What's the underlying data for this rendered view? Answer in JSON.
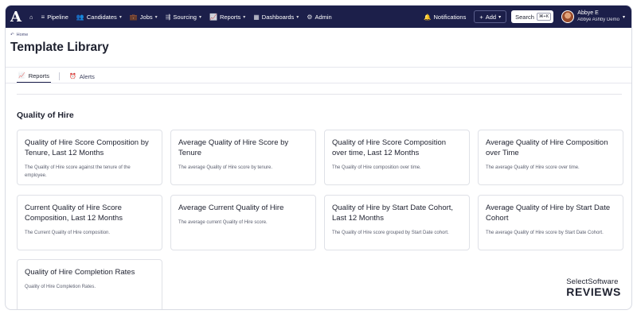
{
  "topnav": {
    "logo": "A",
    "items": [
      {
        "label": "Pipeline",
        "icon": "≡",
        "chev": false
      },
      {
        "label": "Candidates",
        "icon": "👥",
        "chev": true
      },
      {
        "label": "Jobs",
        "icon": "💼",
        "chev": true
      },
      {
        "label": "Sourcing",
        "icon": "⇶",
        "chev": true
      },
      {
        "label": "Reports",
        "icon": "📈",
        "chev": true
      },
      {
        "label": "Dashboards",
        "icon": "▦",
        "chev": true
      },
      {
        "label": "Admin",
        "icon": "⚙",
        "chev": false
      }
    ],
    "notifications_label": "Notifications",
    "add_label": "Add",
    "search_label": "Search",
    "search_shortcut": "⌘+K",
    "user_name": "Abbye E",
    "user_org": "Abbye Ashby Demo"
  },
  "breadcrumb": {
    "label": "Home"
  },
  "page_title": "Template Library",
  "tabs": [
    {
      "label": "Reports",
      "icon": "📈",
      "active": true
    },
    {
      "label": "Alerts",
      "icon": "⏰",
      "active": false
    }
  ],
  "section": {
    "title": "Quality of Hire"
  },
  "cards": [
    {
      "title": "Quality of Hire Score Composition by Tenure, Last 12 Months",
      "description": "The Quality of Hire score against the tenure of the employee."
    },
    {
      "title": "Average Quality of Hire Score by Tenure",
      "description": "The average Quality of Hire score by tenure."
    },
    {
      "title": "Quality of Hire Score Composition over time, Last 12 Months",
      "description": "The Quality of Hire composition over time."
    },
    {
      "title": "Average Quality of Hire Composition over Time",
      "description": "The average Quality of Hire score over time."
    },
    {
      "title": "Current Quality of Hire Score Composition, Last 12 Months",
      "description": "The Current Quality of Hire composition."
    },
    {
      "title": "Average Current Quality of Hire",
      "description": "The average current Quality of Hire score."
    },
    {
      "title": "Quality of Hire by Start Date Cohort, Last 12 Months",
      "description": "The Quality of Hire score grouped by Start Date cohort."
    },
    {
      "title": "Average Quality of Hire by Start Date Cohort",
      "description": "The average Quality of Hire score by Start Date Cohort."
    },
    {
      "title": "Quality of Hire Completion Rates",
      "description": "Quality of Hire Completion Rates."
    }
  ],
  "watermark": {
    "top": "SelectSoftware",
    "bottom": "REVIEWS"
  }
}
